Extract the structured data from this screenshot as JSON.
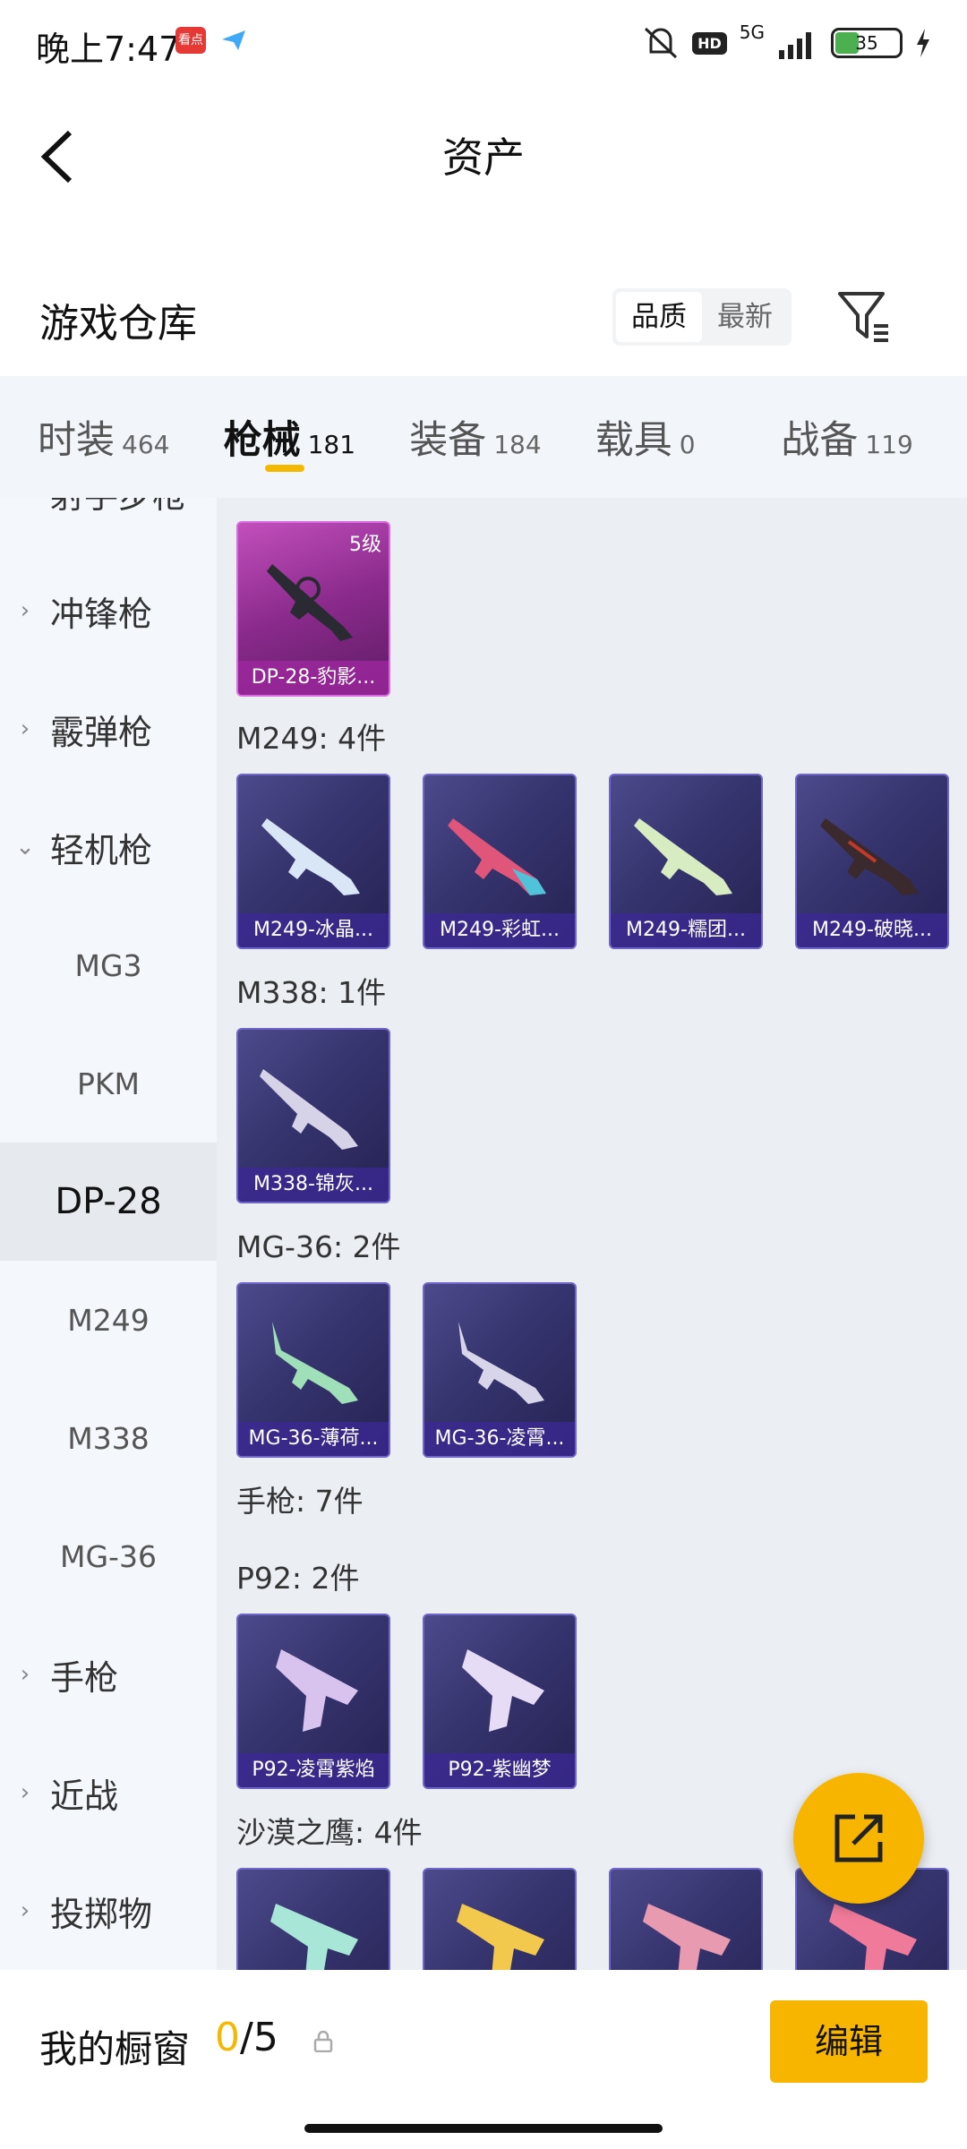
{
  "status_bar": {
    "time": "晚上7:47",
    "app_badge": "看点",
    "hd": "HD",
    "network": "5G",
    "battery": "35"
  },
  "header": {
    "title": "资产"
  },
  "warehouse": {
    "title": "游戏仓库",
    "sort_options": [
      "品质",
      "最新"
    ],
    "sort_selected": "品质"
  },
  "tabs": [
    {
      "label": "时装",
      "count": "464"
    },
    {
      "label": "枪械",
      "count": "181",
      "active": true
    },
    {
      "label": "装备",
      "count": "184"
    },
    {
      "label": "载具",
      "count": "0"
    },
    {
      "label": "战备",
      "count": "119"
    }
  ],
  "sidebar": {
    "items": [
      {
        "label": "射手步枪",
        "type": "parent"
      },
      {
        "label": "冲锋枪",
        "type": "parent"
      },
      {
        "label": "霰弹枪",
        "type": "parent"
      },
      {
        "label": "轻机枪",
        "type": "parent-open"
      },
      {
        "label": "MG3",
        "type": "child"
      },
      {
        "label": "PKM",
        "type": "child"
      },
      {
        "label": "DP-28",
        "type": "child-selected"
      },
      {
        "label": "M249",
        "type": "child"
      },
      {
        "label": "M338",
        "type": "child"
      },
      {
        "label": "MG-36",
        "type": "child"
      },
      {
        "label": "手枪",
        "type": "parent"
      },
      {
        "label": "近战",
        "type": "parent"
      },
      {
        "label": "投掷物",
        "type": "parent"
      }
    ]
  },
  "groups": {
    "dp28": {
      "cards": [
        {
          "name": "DP-28-豹影...",
          "level": "5级"
        }
      ]
    },
    "m249": {
      "header": "M249: 4件",
      "cards": [
        "M249-冰晶...",
        "M249-彩虹...",
        "M249-糯团...",
        "M249-破晓..."
      ]
    },
    "m338": {
      "header": "M338: 1件",
      "cards": [
        "M338-锦灰..."
      ]
    },
    "mg36": {
      "header": "MG-36: 2件",
      "cards": [
        "MG-36-薄荷...",
        "MG-36-凌霄..."
      ]
    },
    "pistol": {
      "header": "手枪: 7件"
    },
    "p92": {
      "header": "P92: 2件",
      "cards": [
        "P92-凌霄紫焰",
        "P92-紫幽梦"
      ]
    },
    "deagle": {
      "header": "沙漠之鹰: 4件"
    }
  },
  "showcase": {
    "label": "我的橱窗",
    "current": "0",
    "total": "/5",
    "edit_label": "编辑"
  },
  "colors": {
    "accent": "#F7B500",
    "card_purple": "#36346E",
    "card_pink": "#8A2A8C"
  }
}
